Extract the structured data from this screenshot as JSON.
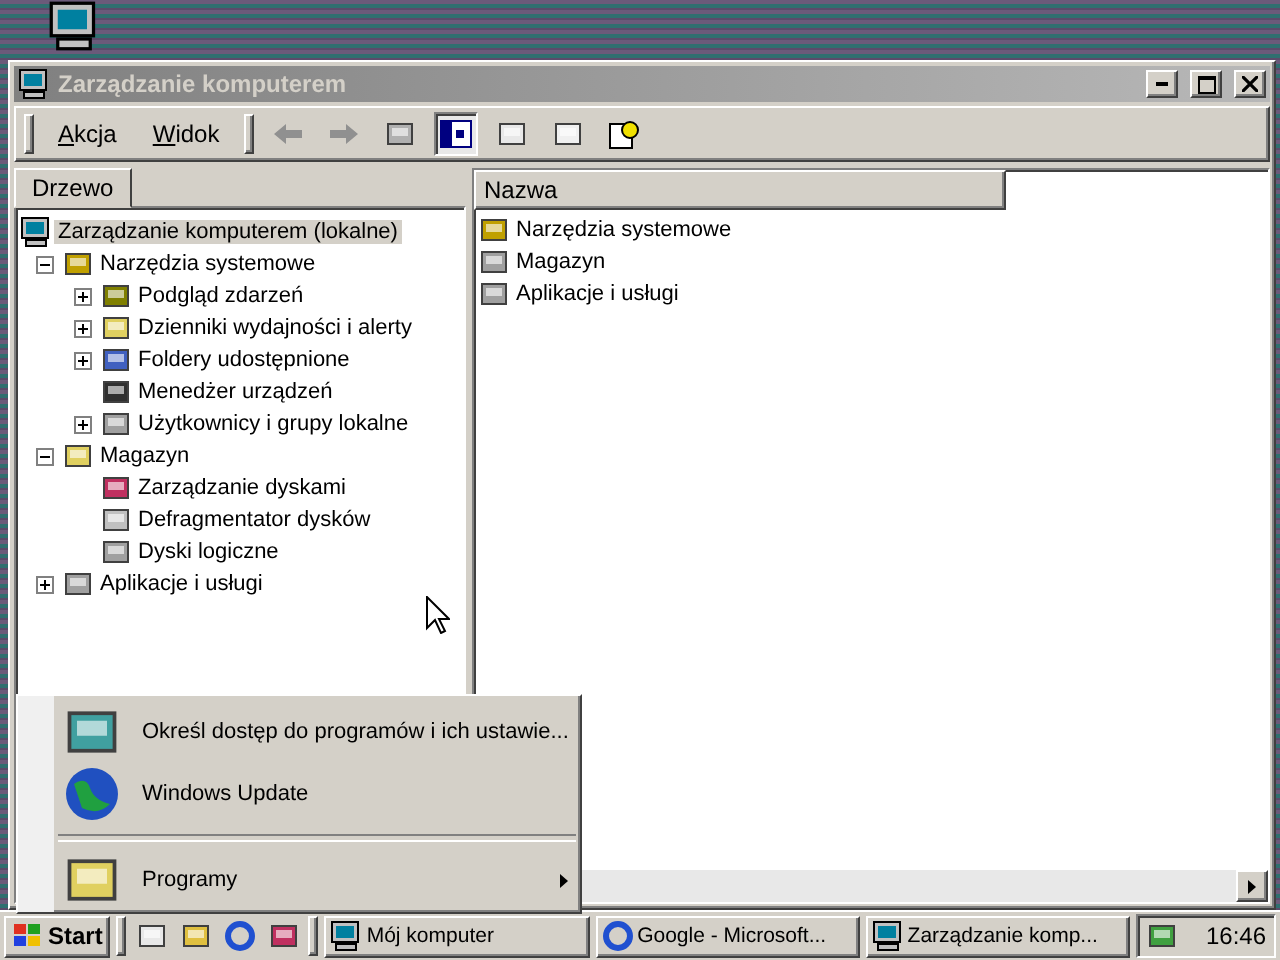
{
  "window": {
    "title": "Zarządzanie komputerem"
  },
  "menu": [
    {
      "label": "Akcja"
    },
    {
      "label": "Widok"
    }
  ],
  "tree_tab": {
    "label": "Drzewo",
    "selected": true
  },
  "tree": [
    {
      "label": "Zarządzanie komputerem (lokalne)",
      "selected": true,
      "children": [
        {
          "label": "Narzędzia systemowe",
          "selected": false,
          "expanded": true,
          "children": [
            {
              "label": "Podgląd zdarzeń",
              "selected": false,
              "expanded": false
            },
            {
              "label": "Dzienniki wydajności i alerty",
              "selected": false,
              "expanded": false
            },
            {
              "label": "Foldery udostępnione",
              "selected": false,
              "expanded": false
            },
            {
              "label": "Menedżer urządzeń",
              "selected": false
            },
            {
              "label": "Użytkownicy i grupy lokalne",
              "selected": false,
              "expanded": false
            }
          ]
        },
        {
          "label": "Magazyn",
          "selected": false,
          "expanded": true,
          "children": [
            {
              "label": "Zarządzanie dyskami",
              "selected": false
            },
            {
              "label": "Defragmentator dysków",
              "selected": false
            },
            {
              "label": "Dyski logiczne",
              "selected": false
            }
          ]
        },
        {
          "label": "Aplikacje i usługi",
          "selected": false,
          "expanded": false
        }
      ]
    }
  ],
  "list": {
    "columns": [
      "Nazwa"
    ],
    "items": [
      "Narzędzia systemowe",
      "Magazyn",
      "Aplikacje i usługi"
    ]
  },
  "start_menu": [
    {
      "kind": "item",
      "label": "Określ dostęp do programów i ich ustawie..."
    },
    {
      "kind": "item",
      "label": "Windows Update"
    },
    {
      "kind": "separator"
    },
    {
      "kind": "submenu",
      "label": "Programy"
    }
  ],
  "taskbar": {
    "start": "Start",
    "tasks": [
      {
        "label": "Mój komputer",
        "selected": false
      },
      {
        "label": "Google - Microsoft...",
        "selected": false
      },
      {
        "label": "Zarządzanie komp...",
        "selected": false
      }
    ],
    "clock": "16:46"
  }
}
